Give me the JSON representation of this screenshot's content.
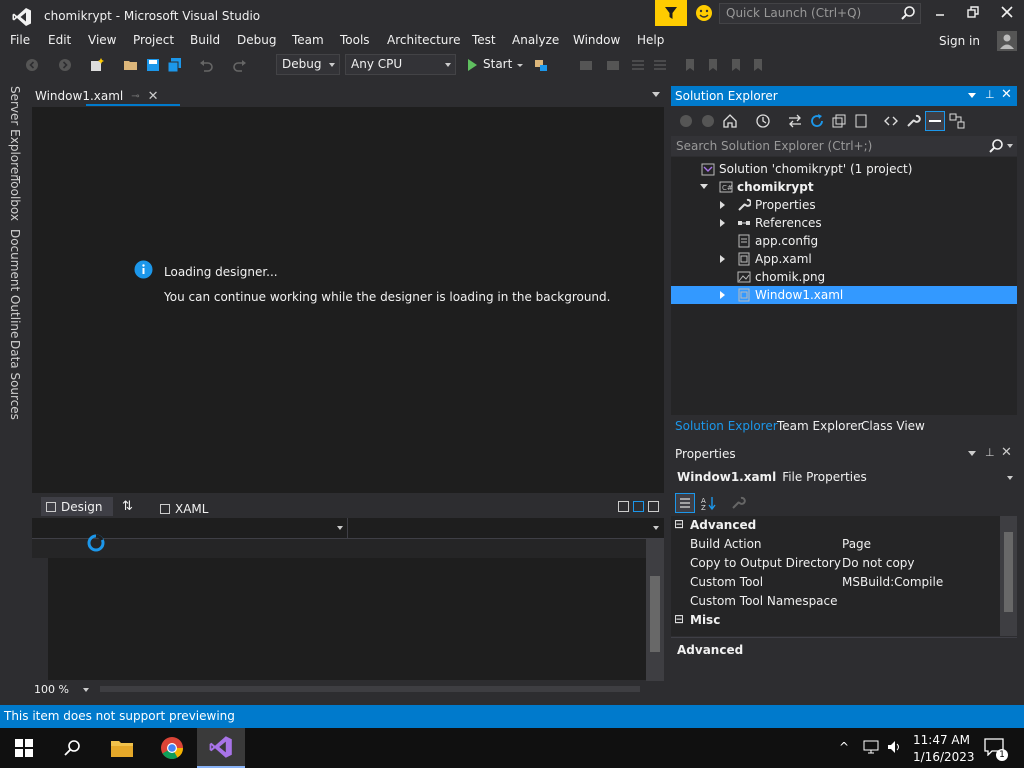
{
  "window": {
    "title": "chomikrypt - Microsoft Visual Studio",
    "quick_launch_placeholder": "Quick Launch (Ctrl+Q)",
    "sign_in": "Sign in"
  },
  "menu": [
    "File",
    "Edit",
    "View",
    "Project",
    "Build",
    "Debug",
    "Team",
    "Tools",
    "Architecture",
    "Test",
    "Analyze",
    "Window",
    "Help"
  ],
  "toolbar": {
    "configuration": "Debug",
    "platform": "Any CPU",
    "start_label": "Start"
  },
  "left_tabs": [
    "Server Explorer",
    "Toolbox",
    "Document Outline",
    "Data Sources"
  ],
  "document": {
    "tab_label": "Window1.xaml",
    "loading_title": "Loading designer...",
    "loading_message": "You can continue working while the designer is loading in the background.",
    "design_tab": "Design",
    "xaml_tab": "XAML",
    "zoom": "100 %"
  },
  "solution_explorer": {
    "title": "Solution Explorer",
    "search_placeholder": "Search Solution Explorer (Ctrl+;)",
    "tree": [
      {
        "label": "Solution 'chomikrypt' (1 project)",
        "icon": "solution-icon",
        "expander": "none",
        "indent": 0
      },
      {
        "label": "chomikrypt",
        "icon": "csharp-project-icon",
        "expander": "expanded",
        "indent": 1,
        "bold": true
      },
      {
        "label": "Properties",
        "icon": "wrench-icon",
        "expander": "collapsed",
        "indent": 2
      },
      {
        "label": "References",
        "icon": "references-icon",
        "expander": "collapsed",
        "indent": 2
      },
      {
        "label": "app.config",
        "icon": "config-file-icon",
        "expander": "none",
        "indent": 2
      },
      {
        "label": "App.xaml",
        "icon": "xaml-file-icon",
        "expander": "collapsed",
        "indent": 2
      },
      {
        "label": "chomik.png",
        "icon": "image-file-icon",
        "expander": "none",
        "indent": 2
      },
      {
        "label": "Window1.xaml",
        "icon": "xaml-file-icon",
        "expander": "collapsed",
        "indent": 2,
        "selected": true
      }
    ],
    "bottom_tabs": [
      "Solution Explorer",
      "Team Explorer",
      "Class View"
    ]
  },
  "properties": {
    "title": "Properties",
    "object_name": "Window1.xaml",
    "object_type": "File Properties",
    "categories": [
      {
        "name": "Advanced",
        "rows": [
          {
            "name": "Build Action",
            "value": "Page"
          },
          {
            "name": "Copy to Output Directory",
            "value": "Do not copy"
          },
          {
            "name": "Custom Tool",
            "value": "MSBuild:Compile"
          },
          {
            "name": "Custom Tool Namespace",
            "value": ""
          }
        ]
      },
      {
        "name": "Misc",
        "rows": []
      }
    ],
    "description_title": "Advanced"
  },
  "status": {
    "text": "This item does not support previewing"
  },
  "taskbar": {
    "time": "11:47 AM",
    "date": "1/16/2023",
    "notification_count": "1"
  },
  "colors": {
    "accent": "#007acc",
    "selection": "#3399ff",
    "background": "#2d2d30",
    "editor": "#1e1e1e"
  }
}
